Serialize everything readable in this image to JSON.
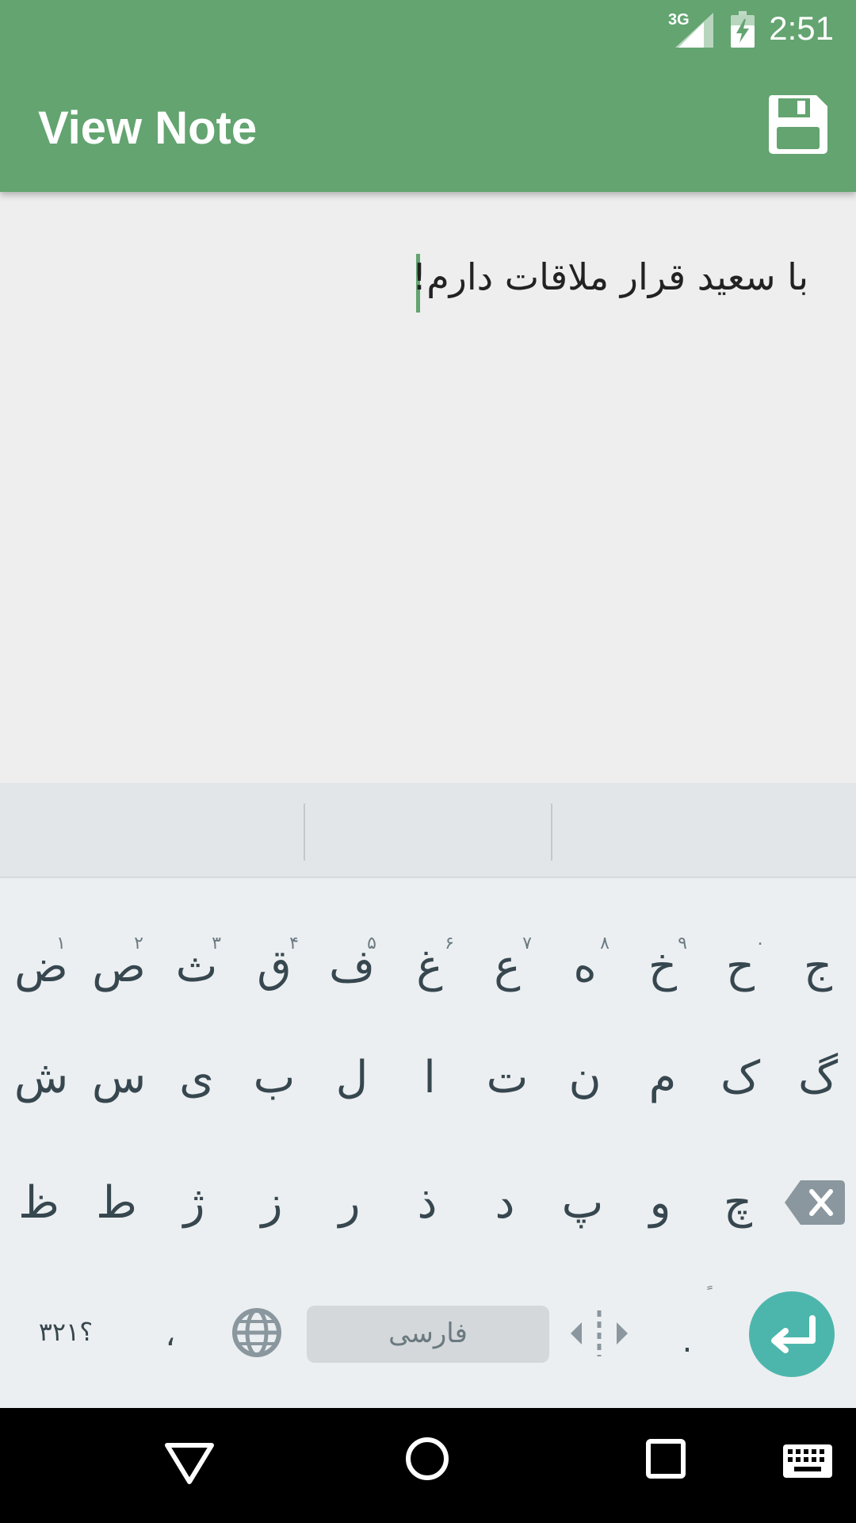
{
  "status_bar": {
    "time": "2:51",
    "network_label": "3G"
  },
  "app_bar": {
    "title": "View Note",
    "save_icon": "floppy-disk-icon"
  },
  "note": {
    "text": "با سعید قرار ملاقات دارم!"
  },
  "keyboard": {
    "row1": [
      {
        "label": "ض",
        "hint": "۱"
      },
      {
        "label": "ص",
        "hint": "۲"
      },
      {
        "label": "ث",
        "hint": "۳"
      },
      {
        "label": "ق",
        "hint": "۴"
      },
      {
        "label": "ف",
        "hint": "۵"
      },
      {
        "label": "غ",
        "hint": "۶"
      },
      {
        "label": "ع",
        "hint": "۷"
      },
      {
        "label": "ه",
        "hint": "۸"
      },
      {
        "label": "خ",
        "hint": "۹"
      },
      {
        "label": "ح",
        "hint": "۰"
      },
      {
        "label": "ج",
        "hint": ""
      }
    ],
    "row2": [
      "ش",
      "س",
      "ی",
      "ب",
      "ل",
      "ا",
      "ت",
      "ن",
      "م",
      "ک",
      "گ"
    ],
    "row3": [
      "ظ",
      "ط",
      "ژ",
      "ز",
      "ر",
      "ذ",
      "د",
      "پ",
      "و",
      "چ"
    ],
    "bottom": {
      "symbols_label": "؟۳۲۱",
      "comma_label": "،",
      "space_label": "فارسی",
      "period_label": ".",
      "period_hint": "ً"
    },
    "accent_color": "#4db6ac"
  },
  "colors": {
    "app_bar": "#63a470",
    "background": "#eeeeee",
    "keyboard": "#eceff1"
  }
}
